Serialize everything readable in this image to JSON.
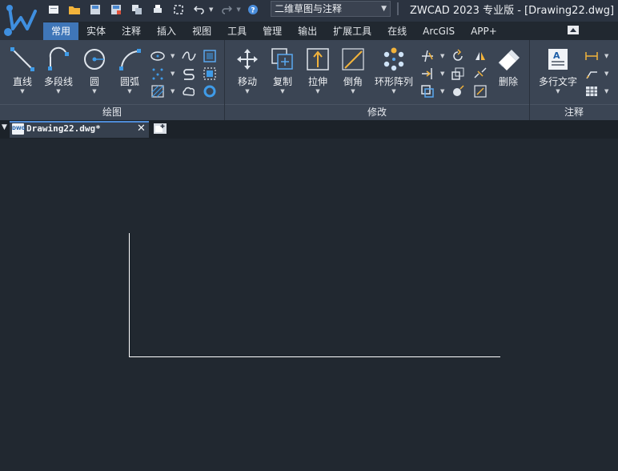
{
  "app": {
    "title": "ZWCAD 2023 专业版 - [Drawing22.dwg]",
    "logo_icon": "zwcad-logo-icon"
  },
  "quick_access": {
    "workspace": "二维草图与注释",
    "icons": [
      "new-icon",
      "open-icon",
      "save-icon",
      "save-as-icon",
      "batch-plot-icon",
      "print-icon",
      "zoom-extents-icon",
      "undo-icon",
      "redo-icon",
      "help-icon"
    ]
  },
  "tabs": [
    "常用",
    "实体",
    "注释",
    "插入",
    "视图",
    "工具",
    "管理",
    "输出",
    "扩展工具",
    "在线",
    "ArcGIS",
    "APP+"
  ],
  "active_tab": "常用",
  "ribbon": {
    "draw": {
      "title": "绘图",
      "tools": [
        "直线",
        "多段线",
        "圆",
        "圆弧"
      ]
    },
    "modify": {
      "title": "修改",
      "tools": [
        "移动",
        "复制",
        "拉伸",
        "倒角",
        "环形阵列",
        "删除"
      ]
    },
    "annotate": {
      "title": "注释",
      "tools": [
        "多行文字"
      ]
    }
  },
  "document": {
    "tab_name": "Drawing22.dwg*",
    "icon_label": "DWG"
  },
  "colors": {
    "accent": "#3f76b8",
    "background": "#212830",
    "ribbon": "#3b4554",
    "line": "#ffffff"
  }
}
